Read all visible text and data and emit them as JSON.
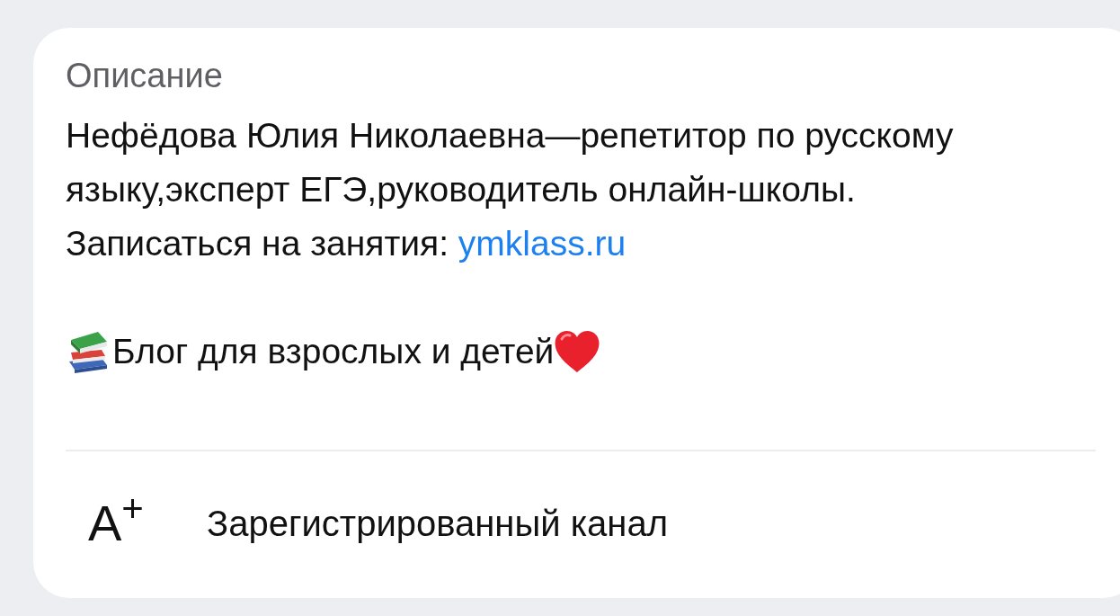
{
  "section": {
    "title": "Описание",
    "description": {
      "text": "Нефёдова Юлия Николаевна—репетитор по русскому языку,эксперт ЕГЭ,руководитель онлайн-школы.",
      "signup_label": "Записаться на занятия:",
      "link": "ymklass.ru",
      "tagline": "Блог для взрослых и детей"
    }
  },
  "status_row": {
    "symbol": "A$^{+}$",
    "label": "Зарегистрированный канал"
  }
}
